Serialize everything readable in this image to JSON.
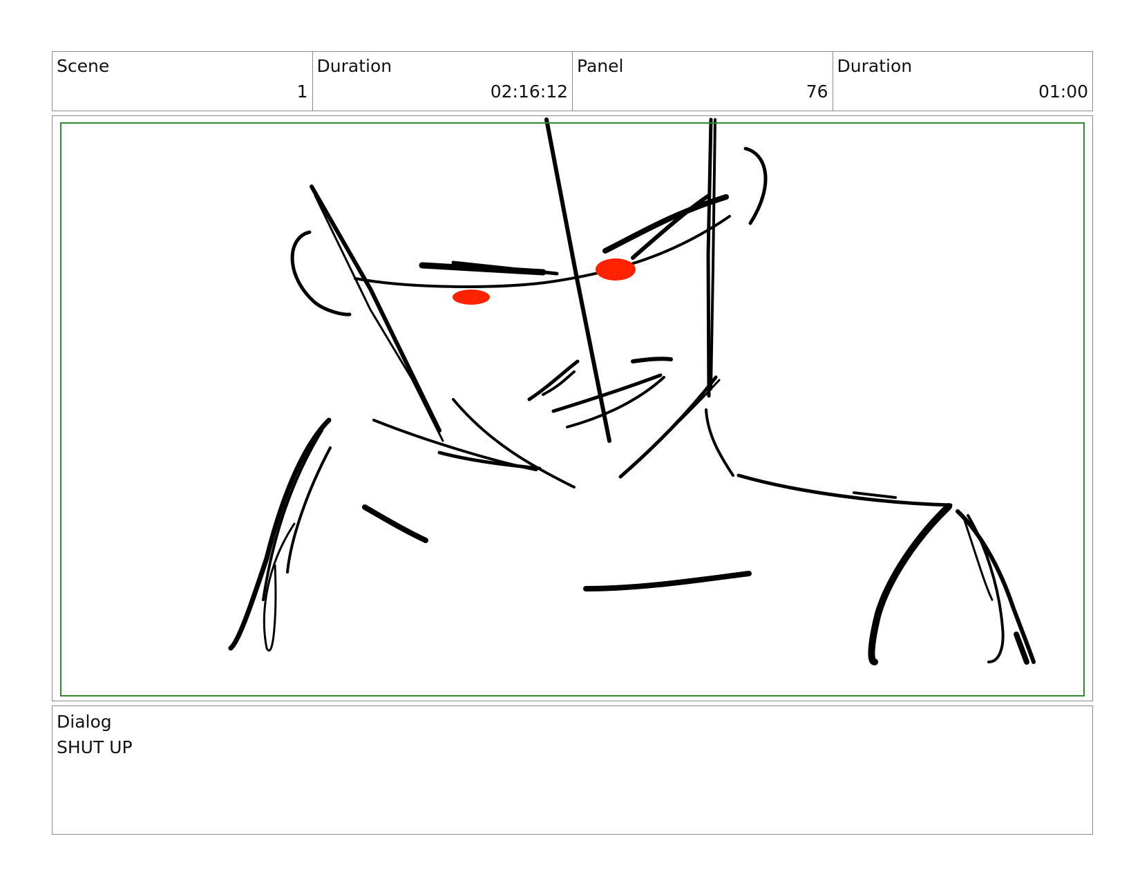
{
  "header": {
    "scene": {
      "label": "Scene",
      "value": "1"
    },
    "scene_duration": {
      "label": "Duration",
      "value": "02:16:12"
    },
    "panel": {
      "label": "Panel",
      "value": "76"
    },
    "panel_duration": {
      "label": "Duration",
      "value": "01:00"
    }
  },
  "panel_image": {
    "line_color": "#000000",
    "eye_color": "#ff2200",
    "safe_area_color": "#2f8a2f"
  },
  "dialog": {
    "label": "Dialog",
    "text": "SHUT UP"
  }
}
